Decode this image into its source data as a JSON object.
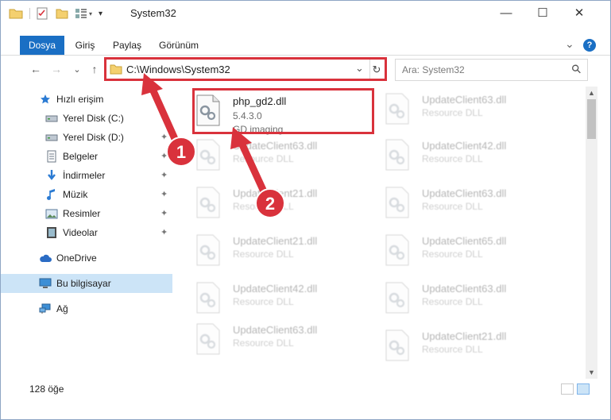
{
  "window": {
    "title": "System32",
    "min_glyph": "—",
    "max_glyph": "☐",
    "close_glyph": "✕"
  },
  "ribbon": {
    "tabs": [
      {
        "label": "Dosya",
        "active": true
      },
      {
        "label": "Giriş"
      },
      {
        "label": "Paylaş"
      },
      {
        "label": "Görünüm"
      }
    ],
    "expand_glyph": "⌄",
    "help_glyph": "?"
  },
  "nav": {
    "back_glyph": "←",
    "forward_glyph": "→",
    "recent_glyph": "⌄",
    "up_glyph": "↑",
    "address": "C:\\Windows\\System32",
    "address_dropdown_glyph": "⌄",
    "refresh_glyph": "↻",
    "search_placeholder": "Ara: System32",
    "search_glyph": "⚲"
  },
  "sidebar": {
    "items": [
      {
        "label": "Hızlı erişim",
        "icon": "star-icon"
      },
      {
        "label": "Yerel Disk (C:)",
        "icon": "drive-icon",
        "pinned": true
      },
      {
        "label": "Yerel Disk (D:)",
        "icon": "drive-icon",
        "pinned": true
      },
      {
        "label": "Belgeler",
        "icon": "documents-icon",
        "pinned": true
      },
      {
        "label": "İndirmeler",
        "icon": "download-icon",
        "pinned": true
      },
      {
        "label": "Müzik",
        "icon": "music-icon",
        "pinned": true
      },
      {
        "label": "Resimler",
        "icon": "pictures-icon",
        "pinned": true
      },
      {
        "label": "Videolar",
        "icon": "videos-icon",
        "pinned": true
      },
      {
        "label": "OneDrive",
        "icon": "cloud-icon"
      },
      {
        "label": "Bu bilgisayar",
        "icon": "computer-icon",
        "selected": true
      },
      {
        "label": "Ağ",
        "icon": "network-icon"
      }
    ],
    "pin_glyph": "📌"
  },
  "files": {
    "highlighted": {
      "name": "php_gd2.dll",
      "version": "5.4.3.0",
      "description": "GD imaging"
    },
    "left_column": [
      {
        "name": "UpdateClient63.dll",
        "description": "Resource DLL"
      },
      {
        "name": "UpdateClient21.dll",
        "description": "Resource DLL"
      },
      {
        "name": "UpdateClient21.dll",
        "description": "Resource DLL"
      },
      {
        "name": "UpdateClient42.dll",
        "description": "Resource DLL"
      },
      {
        "name": "UpdateClient63.dll",
        "description": "Resource DLL"
      }
    ],
    "right_column": [
      {
        "name": "UpdateClient63.dll",
        "description": "Resource DLL"
      },
      {
        "name": "UpdateClient42.dll",
        "description": "Resource DLL"
      },
      {
        "name": "UpdateClient63.dll",
        "description": "Resource DLL"
      },
      {
        "name": "UpdateClient65.dll",
        "description": "Resource DLL"
      },
      {
        "name": "UpdateClient63.dll",
        "description": "Resource DLL"
      },
      {
        "name": "UpdateClient21.dll",
        "description": "Resource DLL"
      }
    ]
  },
  "status": {
    "count": "128 öğe"
  },
  "annotations": [
    {
      "number": "1",
      "color": "#d9323c"
    },
    {
      "number": "2",
      "color": "#d9323c"
    }
  ],
  "colors": {
    "accent": "#1a6fc4",
    "selection": "#cce4f7",
    "annotation": "#d9323c"
  }
}
